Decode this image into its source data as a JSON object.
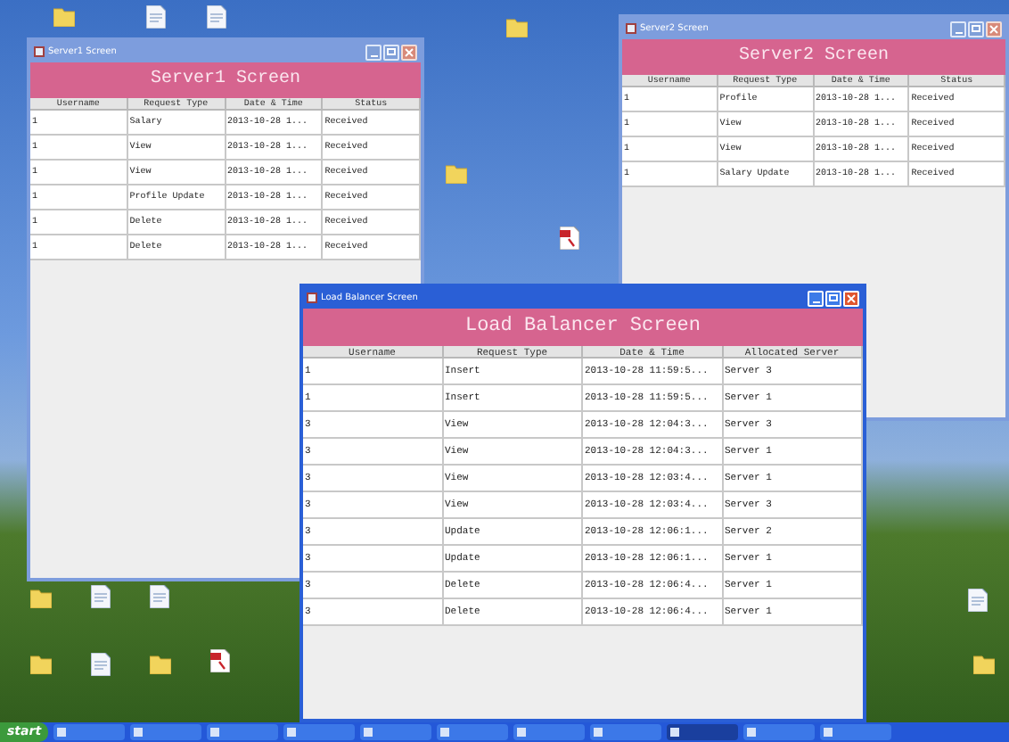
{
  "server1_window": {
    "title": "Server1 Screen",
    "heading": "Server1 Screen",
    "columns": [
      "Username",
      "Request Type",
      "Date & Time",
      "Status"
    ],
    "rows": [
      [
        "1",
        "Salary",
        "2013-10-28 1...",
        "Received"
      ],
      [
        "1",
        "View",
        "2013-10-28 1...",
        "Received"
      ],
      [
        "1",
        "View",
        "2013-10-28 1...",
        "Received"
      ],
      [
        "1",
        "Profile Update",
        "2013-10-28 1...",
        "Received"
      ],
      [
        "1",
        "Delete",
        "2013-10-28 1...",
        "Received"
      ],
      [
        "1",
        "Delete",
        "2013-10-28 1...",
        "Received"
      ]
    ]
  },
  "server2_window": {
    "title": "Server2 Screen",
    "heading": "Server2 Screen",
    "columns": [
      "Username",
      "Request Type",
      "Date & Time",
      "Status"
    ],
    "rows": [
      [
        "1",
        "Profile",
        "2013-10-28 1...",
        "Received"
      ],
      [
        "1",
        "View",
        "2013-10-28 1...",
        "Received"
      ],
      [
        "1",
        "View",
        "2013-10-28 1...",
        "Received"
      ],
      [
        "1",
        "Salary Update",
        "2013-10-28 1...",
        "Received"
      ]
    ]
  },
  "load_balancer_window": {
    "title": "Load Balancer Screen",
    "heading": "Load Balancer Screen",
    "columns": [
      "Username",
      "Request Type",
      "Date & Time",
      "Allocated Server"
    ],
    "rows": [
      [
        "1",
        "Insert",
        "2013-10-28 11:59:5...",
        "Server 3"
      ],
      [
        "1",
        "Insert",
        "2013-10-28 11:59:5...",
        "Server 1"
      ],
      [
        "3",
        "View",
        "2013-10-28 12:04:3...",
        "Server 3"
      ],
      [
        "3",
        "View",
        "2013-10-28 12:04:3...",
        "Server 1"
      ],
      [
        "3",
        "View",
        "2013-10-28 12:03:4...",
        "Server 1"
      ],
      [
        "3",
        "View",
        "2013-10-28 12:03:4...",
        "Server 3"
      ],
      [
        "3",
        "Update",
        "2013-10-28 12:06:1...",
        "Server 2"
      ],
      [
        "3",
        "Update",
        "2013-10-28 12:06:1...",
        "Server 1"
      ],
      [
        "3",
        "Delete",
        "2013-10-28 12:06:4...",
        "Server 1"
      ],
      [
        "3",
        "Delete",
        "2013-10-28 12:06:4...",
        "Server 1"
      ]
    ]
  },
  "taskbar": {
    "start_label": "start"
  }
}
